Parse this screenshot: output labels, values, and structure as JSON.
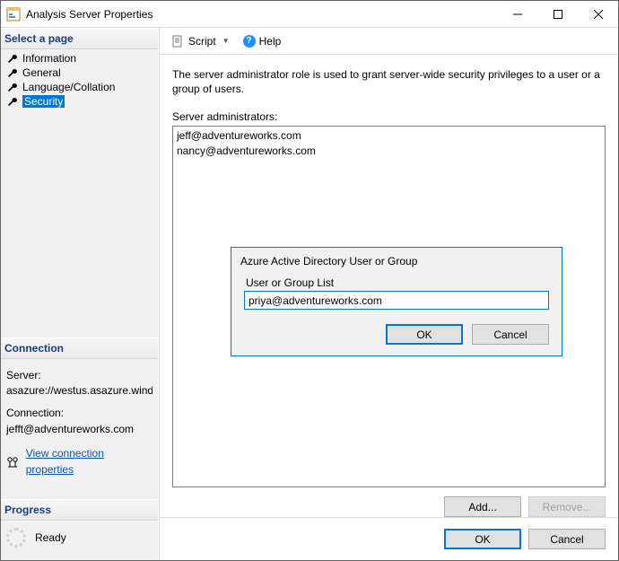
{
  "window": {
    "title": "Analysis Server Properties"
  },
  "pages": {
    "heading": "Select a page",
    "items": [
      {
        "label": "Information",
        "selected": false
      },
      {
        "label": "General",
        "selected": false
      },
      {
        "label": "Language/Collation",
        "selected": false
      },
      {
        "label": "Security",
        "selected": true
      }
    ]
  },
  "connection": {
    "heading": "Connection",
    "server_label": "Server:",
    "server_value": "asazure://westus.asazure.windows",
    "conn_label": "Connection:",
    "conn_value": "jefft@adventureworks.com",
    "link_text": "View connection properties"
  },
  "progress": {
    "heading": "Progress",
    "status": "Ready"
  },
  "toolbar": {
    "script_label": "Script",
    "help_label": "Help"
  },
  "main": {
    "description": "The server administrator role is used to grant server-wide security privileges to a user or a group of users.",
    "list_label": "Server administrators:",
    "administrators": [
      "jeff@adventureworks.com",
      "nancy@adventureworks.com"
    ],
    "add_label": "Add...",
    "remove_label": "Remove..."
  },
  "dialog": {
    "title": "Azure Active Directory User or Group",
    "field_label": "User or Group List",
    "input_value": "priya@adventureworks.com",
    "ok_label": "OK",
    "cancel_label": "Cancel"
  },
  "footer": {
    "ok_label": "OK",
    "cancel_label": "Cancel"
  }
}
